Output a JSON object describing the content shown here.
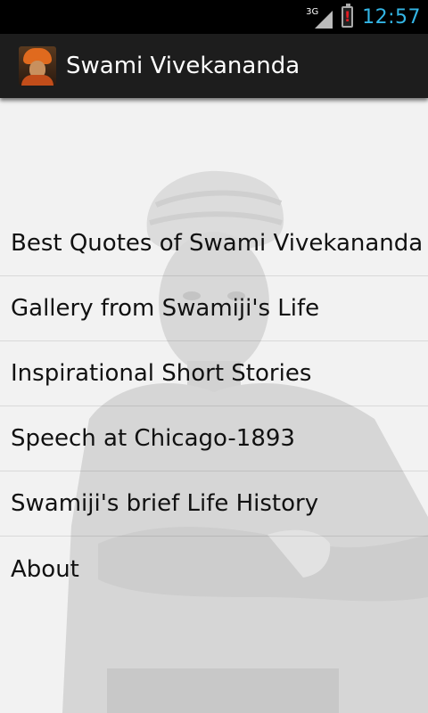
{
  "status_bar": {
    "network_type": "3G",
    "time": "12:57",
    "battery_alert": "!",
    "accent_color": "#33b5e5"
  },
  "action_bar": {
    "title": "Swami Vivekananda",
    "icon": "app-portrait-icon"
  },
  "menu": {
    "items": [
      {
        "label": "Best Quotes of Swami Vivekananda"
      },
      {
        "label": "Gallery from Swamiji's Life"
      },
      {
        "label": "Inspirational Short Stories"
      },
      {
        "label": "Speech at Chicago-1893"
      },
      {
        "label": "Swamiji's brief Life History"
      },
      {
        "label": "About"
      }
    ]
  },
  "background": {
    "image": "faded-portrait-of-swami-vivekananda"
  }
}
